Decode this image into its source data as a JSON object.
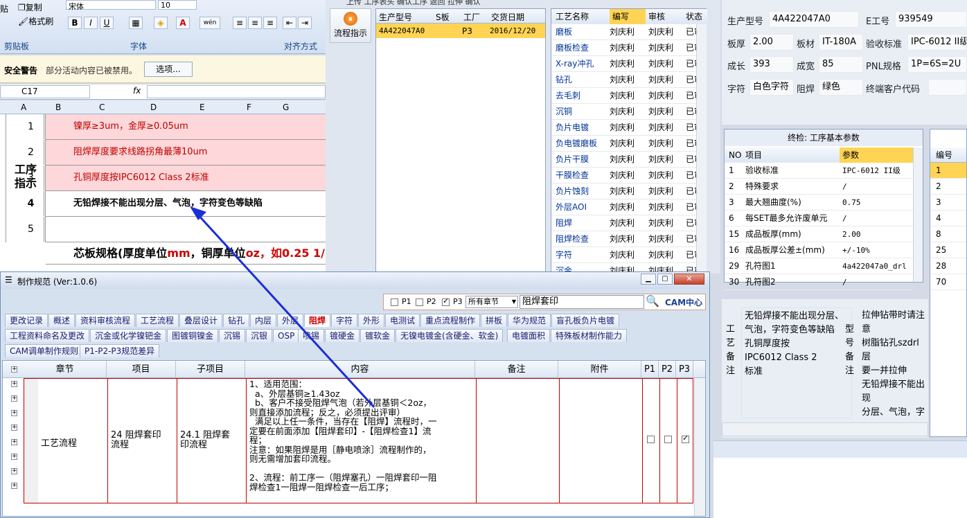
{
  "ribbon": {
    "paste": "贴",
    "copy": "复制",
    "format_painter": "格式刷",
    "clipboard": "剪贴板",
    "font_name": "宋体",
    "font_size": "10",
    "font_group": "字体",
    "align_group": "对齐方式",
    "bold": "B",
    "italic": "I",
    "underline": "U",
    "font_color": "A",
    "wen": "wén"
  },
  "security": {
    "label": "安全警告",
    "text": "部分活动内容已被禁用。",
    "button": "选项..."
  },
  "formula": {
    "cell_ref": "C17",
    "fx": "fx"
  },
  "sheet": {
    "columns": [
      "A",
      "B",
      "C",
      "D",
      "E",
      "F",
      "G"
    ],
    "label_a": "工序\n指示",
    "rows": [
      {
        "num": "1",
        "text": "镍厚≥3um，金厚≥0.05um"
      },
      {
        "num": "2",
        "text": "阻焊厚度要求线路拐角最薄10um"
      },
      {
        "num": "3",
        "text": "孔铜厚度按IPC6012  Class 2标准"
      },
      {
        "num": "4",
        "text": "无铅焊接不能出现分层、气泡，字符变色等缺陷"
      },
      {
        "num": "5",
        "text": ""
      }
    ],
    "row6_a": "芯板规格(厚度单位",
    "row6_b": "mm",
    "row6_c": "，铜厚单位",
    "row6_d": "oz",
    "row6_e": "，如0.25 1/"
  },
  "toolbar_top": "上传  工序表头  确认工序  返回  拉伸  确认",
  "flow_button": "流程指示",
  "orders": {
    "headers": [
      "生产型号",
      "S板",
      "工厂",
      "交货日期"
    ],
    "rows": [
      {
        "model": "4A422047A0",
        "s": "",
        "factory": "P3",
        "date": "2016/12/20"
      }
    ]
  },
  "process": {
    "headers": [
      "工艺名称",
      "编写",
      "审核",
      "状态"
    ],
    "rows": [
      {
        "n": "磨板",
        "w": "刘庆利",
        "r": "刘庆利",
        "s": "已审"
      },
      {
        "n": "磨板检查",
        "w": "刘庆利",
        "r": "刘庆利",
        "s": "已审"
      },
      {
        "n": "X-ray冲孔",
        "w": "刘庆利",
        "r": "刘庆利",
        "s": "已审"
      },
      {
        "n": "钻孔",
        "w": "刘庆利",
        "r": "刘庆利",
        "s": "已审"
      },
      {
        "n": "去毛刺",
        "w": "刘庆利",
        "r": "刘庆利",
        "s": "已审"
      },
      {
        "n": "沉铜",
        "w": "刘庆利",
        "r": "刘庆利",
        "s": "已审"
      },
      {
        "n": "负片电镀",
        "w": "刘庆利",
        "r": "刘庆利",
        "s": "已审"
      },
      {
        "n": "负电镀磨板",
        "w": "刘庆利",
        "r": "刘庆利",
        "s": "已审"
      },
      {
        "n": "负片干膜",
        "w": "刘庆利",
        "r": "刘庆利",
        "s": "已审"
      },
      {
        "n": "干膜检查",
        "w": "刘庆利",
        "r": "刘庆利",
        "s": "已审"
      },
      {
        "n": "负片蚀刻",
        "w": "刘庆利",
        "r": "刘庆利",
        "s": "已审"
      },
      {
        "n": "外层AOI",
        "w": "刘庆利",
        "r": "刘庆利",
        "s": "已审"
      },
      {
        "n": "阻焊",
        "w": "刘庆利",
        "r": "刘庆利",
        "s": "已审"
      },
      {
        "n": "阻焊检查",
        "w": "刘庆利",
        "r": "刘庆利",
        "s": "已审"
      },
      {
        "n": "字符",
        "w": "刘庆利",
        "r": "刘庆利",
        "s": "已审"
      },
      {
        "n": "沉金",
        "w": "刘庆利",
        "r": "刘庆利",
        "s": "已审"
      }
    ]
  },
  "info": {
    "model_label": "生产型号",
    "model": "4A422047A0",
    "eno_label": "E工号",
    "eno": "939549",
    "thick_label": "板厚",
    "thick": "2.00",
    "mat_label": "板材",
    "mat": "IT-180A",
    "std_label": "验收标准",
    "std": "IPC-6012 II级",
    "len_label": "成长",
    "len": "393",
    "wid_label": "成宽",
    "wid": "85",
    "pnl_label": "PNL规格",
    "pnl": "1P=6S=2U",
    "char_label": "字符",
    "char": "白色字符",
    "mask_label": "阻焊",
    "mask": "绿色",
    "cust_label": "终端客户代码",
    "cust": ""
  },
  "params": {
    "title": "终检: 工序基本参数",
    "headers": [
      "NO",
      "项目",
      "参数"
    ],
    "rows": [
      {
        "no": "1",
        "item": "验收标准",
        "val": "IPC-6012 II级"
      },
      {
        "no": "2",
        "item": "特殊要求",
        "val": "/"
      },
      {
        "no": "3",
        "item": "最大翘曲度(%)",
        "val": "0.75"
      },
      {
        "no": "6",
        "item": "每SET最多允许废单元",
        "val": "/"
      },
      {
        "no": "15",
        "item": "成品板厚(mm)",
        "val": "2.00"
      },
      {
        "no": "16",
        "item": "成品板厚公差±(mm)",
        "val": "+/-10%"
      },
      {
        "no": "29",
        "item": "孔符图1",
        "val": "4a422047a0_drl"
      },
      {
        "no": "30",
        "item": "孔符图2",
        "val": "/"
      }
    ]
  },
  "rside": {
    "header": "编号",
    "items": [
      "1",
      "2",
      "3",
      "4",
      "8",
      "25",
      "28",
      "70"
    ]
  },
  "notes": {
    "left_label": "工\n艺\n备\n注",
    "left_text": "无铅焊接不能出现分层、气泡，字符变色等缺陷\n孔铜厚度按\nIPC6012 Class 2\n标准",
    "right_label": "型\n号\n备\n注",
    "right_text": "拉伸钻带时请注意\n树脂钻孔szdrl层\n要一并拉伸\n无铅焊接不能出现\n分层、气泡，字符\n变色等缺陷"
  },
  "dialog": {
    "title": "制作规范 (Ver:1.0.6)",
    "p1": "P1",
    "p2": "P2",
    "p3": "P3",
    "chapter": "所有章节",
    "search": "阻焊套印",
    "logo": "CAM中心",
    "tabs1": [
      "更改记录",
      "概述",
      "资料审核流程",
      "工艺流程",
      "叠层设计",
      "钻孔",
      "内层",
      "外层",
      "阻焊",
      "字符",
      "外形",
      "电测试",
      "重点流程制作",
      "拼板",
      "华为规范",
      "盲孔板负片电镀"
    ],
    "tabs2": [
      "工程资料命名及更改",
      "沉金或化学镍钯金",
      "图镀铜镍金",
      "沉锡",
      "沉银",
      "OSP",
      "喷锡",
      "镀硬金",
      "镀软金",
      "无镍电镀金(含硬金、软金)",
      "电镀面积",
      "特殊板材制作能力"
    ],
    "tabs3": [
      "CAM调单制作规则",
      "P1-P2-P3规范差异"
    ],
    "headers": [
      "章节",
      "项目",
      "子项目",
      "内容",
      "备注",
      "附件",
      "P1",
      "P2",
      "P3"
    ],
    "row": {
      "chapter": "工艺流程",
      "item": "24 阻焊套印\n流程",
      "sub": "24.1 阻焊套\n印流程",
      "content": "1、适用范围：\n  a、外层基铜≥1.43oz\n  b、客户不接受阻焊气泡（若外层基铜＜2oz，\n则直接添加流程；反之，必须提出评审）\n  满足以上任一条件，当存在【阻焊】流程时，一\n定要在前面添加【阻焊套印】-【阻焊检查1】流\n程；\n注意：如果阻焊是用［静电喷涂］流程制作的，\n则无需增加套印流程。\n\n2、流程：前工序一（阻焊塞孔）一阻焊套印一阻\n焊检查1一阻焊一阻焊检查一后工序；"
    }
  }
}
